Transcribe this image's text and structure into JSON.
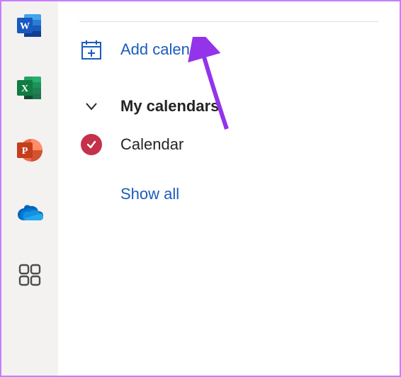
{
  "rail": {
    "apps": [
      {
        "name": "word-icon"
      },
      {
        "name": "excel-icon"
      },
      {
        "name": "powerpoint-icon"
      },
      {
        "name": "onedrive-icon"
      },
      {
        "name": "apps-icon"
      }
    ]
  },
  "sidebar": {
    "add_calendar_label": "Add calendar",
    "section_title": "My calendars",
    "calendar_item": "Calendar",
    "show_all_label": "Show all"
  }
}
